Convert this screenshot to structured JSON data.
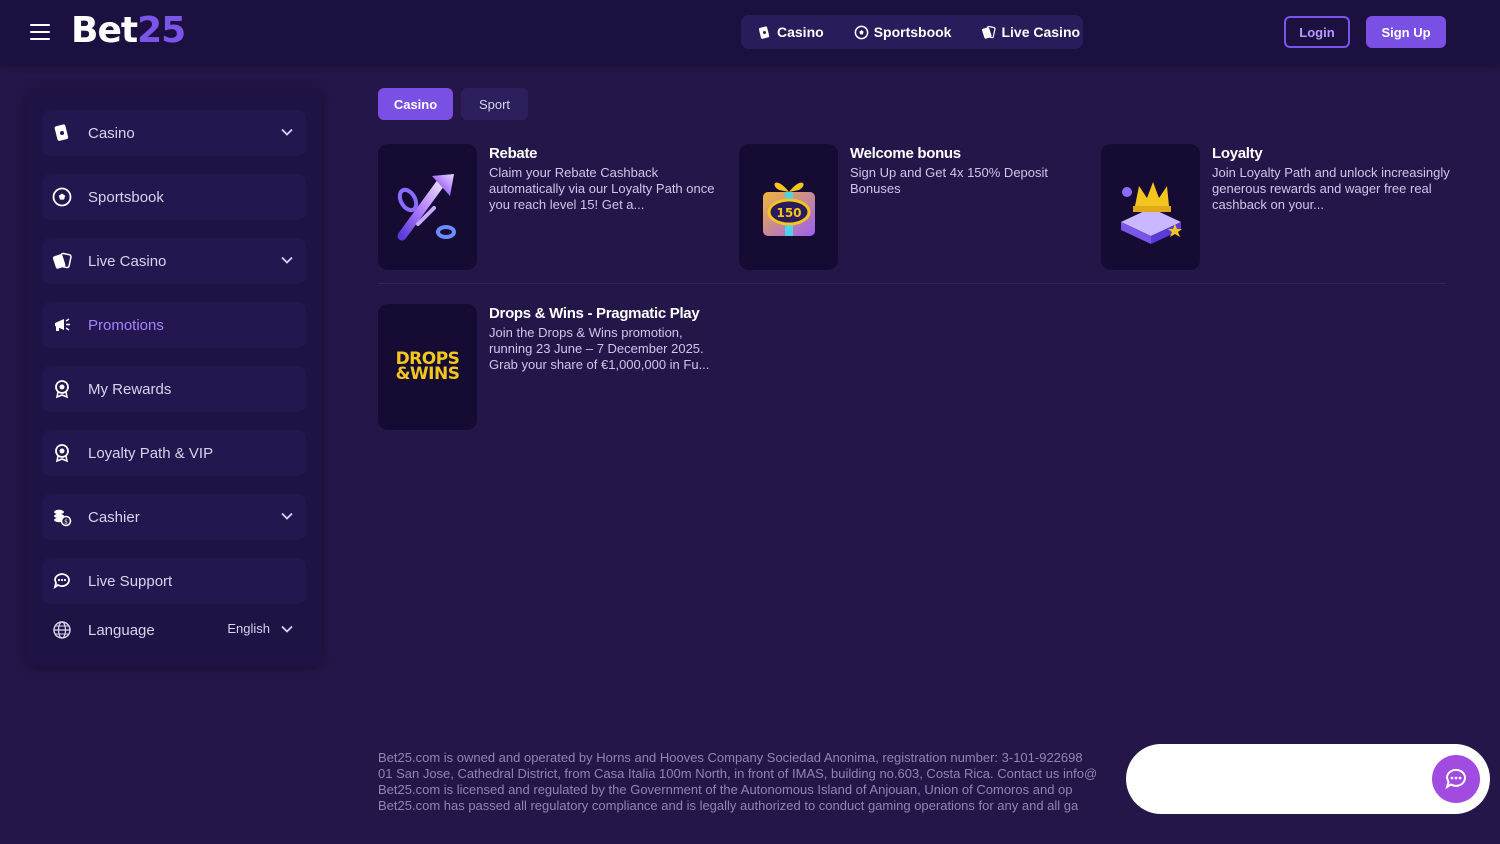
{
  "brand": {
    "logo_bet": "Bet",
    "logo_num": "25",
    "accent": "#7a4fe4"
  },
  "header": {
    "nav": [
      {
        "label": "Casino",
        "icon": "cards-icon"
      },
      {
        "label": "Sportsbook",
        "icon": "soccer-ball-icon"
      },
      {
        "label": "Live Casino",
        "icon": "live-cards-icon"
      }
    ],
    "login_label": "Login",
    "signup_label": "Sign Up"
  },
  "sidebar": {
    "items": [
      {
        "label": "Casino",
        "icon": "cards-icon",
        "expandable": true
      },
      {
        "label": "Sportsbook",
        "icon": "soccer-ball-icon"
      },
      {
        "label": "Live Casino",
        "icon": "live-cards-icon",
        "expandable": true
      },
      {
        "label": "Promotions",
        "icon": "megaphone-icon",
        "active": true
      },
      {
        "label": "My Rewards",
        "icon": "rewards-icon"
      },
      {
        "label": "Loyalty Path & VIP",
        "icon": "badge-icon"
      },
      {
        "label": "Cashier",
        "icon": "coins-icon",
        "expandable": true
      },
      {
        "label": "Live Support",
        "icon": "chat-icon"
      }
    ],
    "language": {
      "label": "Language",
      "value": "English",
      "icon": "globe-icon"
    }
  },
  "tabs": [
    {
      "label": "Casino",
      "active": true
    },
    {
      "label": "Sport",
      "active": false
    }
  ],
  "promotions": [
    {
      "title": "Rebate",
      "description": "Claim your Rebate Cashback automatically via our Loyalty Path once you reach level 15! Get a..."
    },
    {
      "title": "Welcome bonus",
      "description": "Sign Up and Get 4x 150% Deposit Bonuses"
    },
    {
      "title": "Loyalty",
      "description": "Join Loyalty Path and unlock increasingly generous rewards and wager free real cashback on your..."
    },
    {
      "title": "Drops & Wins - Pragmatic Play",
      "description": "Join the Drops & Wins promotion, running 23 June – 7 December 2025. Grab your share of €1,000,000 in Fu...",
      "thumb_text_1": "DROPS",
      "thumb_text_2": "&WINS"
    }
  ],
  "footer": {
    "lines": [
      "Bet25.com is owned and operated by Horns and Hooves Company Sociedad Anonima, registration number: 3-101-922698",
      "01 San Jose, Cathedral District, from Casa Italia 100m North, in front of IMAS, building no.603, Costa Rica. Contact us info@",
      "Bet25.com is licensed and regulated by the Government of the Autonomous Island of Anjouan, Union of Comoros and op",
      "Bet25.com has passed all regulatory compliance and is legally authorized to conduct gaming operations for any and all ga"
    ]
  }
}
